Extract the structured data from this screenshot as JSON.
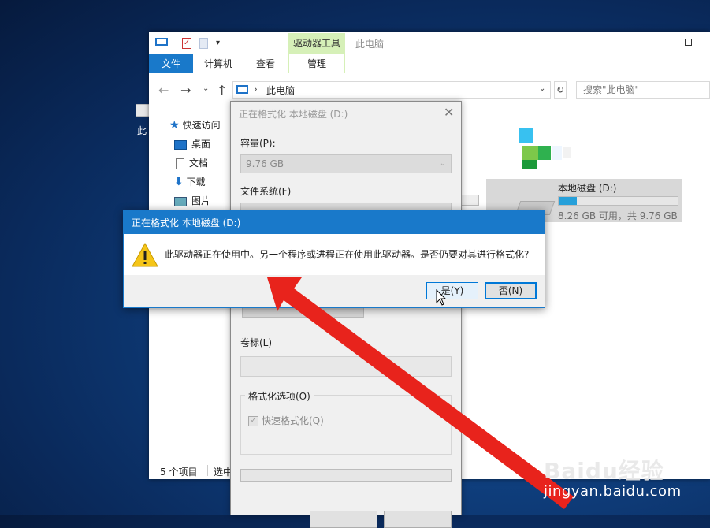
{
  "desktop": {
    "icon_label": "此"
  },
  "explorer": {
    "title": "此电脑",
    "contextual_tab": "驱动器工具",
    "ribbon_tabs": {
      "file": "文件",
      "computer": "计算机",
      "view": "查看",
      "manage": "管理"
    },
    "address": {
      "path": "此电脑",
      "search_placeholder": "搜索\"此电脑\""
    },
    "nav_pane": {
      "quick_access": "快速访问",
      "items": [
        "桌面",
        "文档",
        "下载",
        "图片"
      ]
    },
    "drive": {
      "name": "本地磁盘 (D:)",
      "space": "8.26 GB 可用，共 9.76 GB",
      "used_fraction": 0.154
    },
    "status": {
      "count": "5 个项目",
      "selected": "选中"
    }
  },
  "format_dialog": {
    "title": "正在格式化 本地磁盘 (D:)",
    "capacity_label": "容量(P):",
    "capacity_value": "9.76 GB",
    "filesystem_label": "文件系统(F)",
    "volume_label": "卷标(L)",
    "options_label": "格式化选项(O)",
    "quick_format": "快速格式化(Q)"
  },
  "warning_dialog": {
    "title": "正在格式化 本地磁盘 (D:)",
    "message": "此驱动器正在使用中。另一个程序或进程正在使用此驱动器。是否仍要对其进行格式化?",
    "yes": "是(Y)",
    "no": "否(N)"
  },
  "watermark": {
    "logo": "Baidu经验",
    "url": "jingyan.baidu.com"
  },
  "colors": {
    "accent": "#1979ca",
    "annotation": "#e8231c",
    "context_tab": "#d6f0b8",
    "drive_fill": "#26a0da"
  },
  "icons": [
    "computer-icon",
    "warning-icon",
    "shield-icon",
    "folder-icon",
    "download-icon"
  ]
}
